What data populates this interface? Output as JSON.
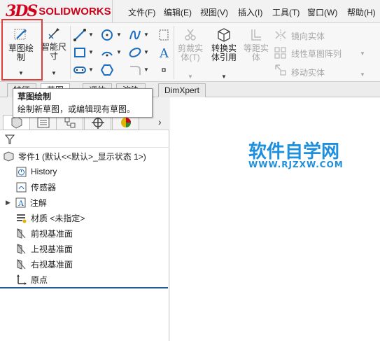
{
  "app": {
    "logo_mark": "3DS",
    "logo_text": "SOLIDWORKS"
  },
  "menu": [
    {
      "label": "文件(F)"
    },
    {
      "label": "编辑(E)"
    },
    {
      "label": "视图(V)"
    },
    {
      "label": "插入(I)"
    },
    {
      "label": "工具(T)"
    },
    {
      "label": "窗口(W)"
    },
    {
      "label": "帮助(H)"
    }
  ],
  "command_manager": {
    "sketch_btn": {
      "line1": "草图绘",
      "line2": "制"
    },
    "smart_dim": {
      "line1": "智能尺",
      "line2": "寸"
    },
    "trim": {
      "line1": "剪裁实",
      "line2": "体(T)"
    },
    "convert": {
      "line1": "转换实",
      "line2": "体引用"
    },
    "offset": {
      "line1": "等距实",
      "line2": "体"
    },
    "mirror": "镜向实体",
    "linear_pattern": "线性草图阵列",
    "move": "移动实体"
  },
  "tabs": [
    {
      "label": "特征"
    },
    {
      "label": "草图"
    },
    {
      "label": "评估"
    },
    {
      "label": "渲染"
    },
    {
      "label": "DimXpert"
    }
  ],
  "tooltip": {
    "title": "草图绘制",
    "desc": "绘制新草图，或编辑现有草图。"
  },
  "tree": {
    "root": "零件1  (默认<<默认>_显示状态 1>)",
    "items": [
      {
        "label": "History",
        "icon": "history-icon"
      },
      {
        "label": "传感器",
        "icon": "sensor-icon"
      },
      {
        "label": "注解",
        "icon": "annotation-icon"
      },
      {
        "label": "材质 <未指定>",
        "icon": "material-icon"
      },
      {
        "label": "前视基准面",
        "icon": "plane-icon"
      },
      {
        "label": "上视基准面",
        "icon": "plane-icon"
      },
      {
        "label": "右视基准面",
        "icon": "plane-icon"
      },
      {
        "label": "原点",
        "icon": "origin-icon"
      }
    ]
  },
  "watermark": {
    "title": "软件自学网",
    "url": "WWW.RJZXW.COM"
  },
  "colors": {
    "accent_red": "#d0021b",
    "highlight_box": "#e23b3b",
    "watermark_blue": "#1e8fdc"
  }
}
